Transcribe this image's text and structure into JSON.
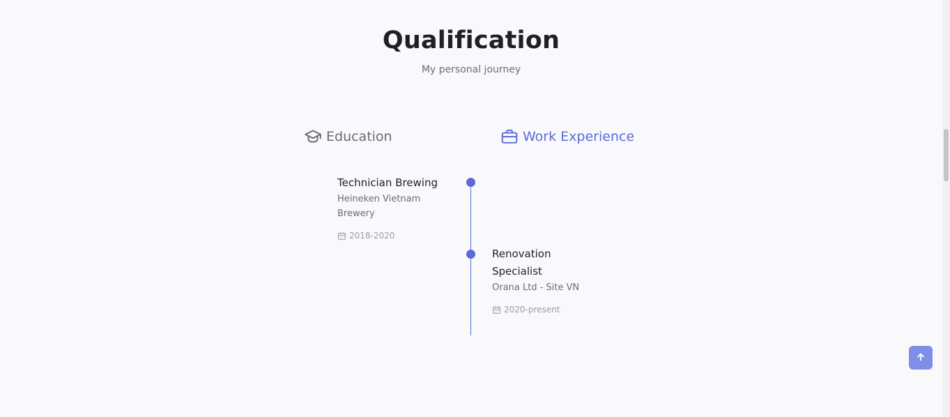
{
  "section": {
    "title": "Qualification",
    "subtitle": "My personal journey"
  },
  "tabs": {
    "education": {
      "label": "Education",
      "icon": "graduation-cap-icon",
      "active": false
    },
    "work": {
      "label": "Work Experience",
      "icon": "briefcase-icon",
      "active": true
    }
  },
  "entries": [
    {
      "title": "Technician Brewing",
      "company": "Heineken Vietnam Brewery",
      "date": "2018-2020",
      "icon": "calendar-icon"
    },
    {
      "title": "Renovation Specialist",
      "company": "Orana Ltd - Site VN",
      "date": "2020-present",
      "icon": "calendar-icon"
    }
  ],
  "scroll_top": {
    "icon": "arrow-up-icon"
  },
  "colors": {
    "accent": "#5a6bd8",
    "text_dark": "#1f1f27",
    "text_muted": "#6a6a76",
    "background": "#f9f9fc"
  }
}
